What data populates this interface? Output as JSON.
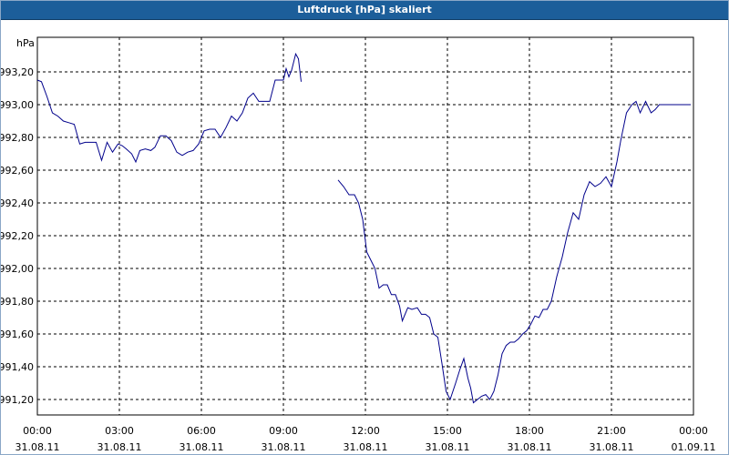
{
  "window": {
    "title": "Luftdruck [hPa] skaliert"
  },
  "chart_data": {
    "type": "line",
    "title": "Luftdruck [hPa] skaliert",
    "yunit": "hPa",
    "ylim": [
      991.1,
      993.4
    ],
    "y_ticks": [
      "993,20",
      "993,00",
      "992,80",
      "992,60",
      "992,40",
      "992,20",
      "992,00",
      "991,80",
      "991,60",
      "991,40",
      "991,20"
    ],
    "y_tick_values": [
      993.2,
      993.0,
      992.8,
      992.6,
      992.4,
      992.2,
      992.0,
      991.8,
      991.6,
      991.4,
      991.2
    ],
    "x_ticks": [
      {
        "time": "00:00",
        "date": "31.08.11"
      },
      {
        "time": "03:00",
        "date": "31.08.11"
      },
      {
        "time": "06:00",
        "date": "31.08.11"
      },
      {
        "time": "09:00",
        "date": "31.08.11"
      },
      {
        "time": "12:00",
        "date": "31.08.11"
      },
      {
        "time": "15:00",
        "date": "31.08.11"
      },
      {
        "time": "18:00",
        "date": "31.08.11"
      },
      {
        "time": "21:00",
        "date": "31.08.11"
      },
      {
        "time": "00:00",
        "date": "01.09.11"
      }
    ],
    "grid": true,
    "line_color": "#00008b",
    "series": [
      {
        "x_hours": [
          0.0,
          0.15,
          0.35,
          0.55,
          0.75,
          0.95,
          1.15,
          1.35,
          1.55,
          1.75,
          1.95,
          2.15,
          2.35,
          2.55,
          2.75,
          2.95,
          3.1,
          3.25,
          3.45,
          3.6,
          3.75,
          3.95,
          4.15,
          4.3,
          4.5,
          4.7,
          4.9,
          5.1,
          5.3,
          5.5,
          5.7,
          5.9,
          6.1,
          6.3,
          6.5,
          6.7,
          6.9,
          7.1,
          7.3,
          7.5,
          7.7,
          7.9,
          8.1,
          8.3,
          8.5,
          8.7,
          8.9,
          9.0,
          9.1,
          9.2,
          9.3,
          9.45,
          9.55,
          9.65
        ],
        "y": [
          993.15,
          993.14,
          993.05,
          992.95,
          992.93,
          992.9,
          992.89,
          992.88,
          992.76,
          992.77,
          992.77,
          992.77,
          992.66,
          992.77,
          992.71,
          992.76,
          992.75,
          992.73,
          992.7,
          992.65,
          992.72,
          992.73,
          992.72,
          992.74,
          992.81,
          992.81,
          992.78,
          992.71,
          992.69,
          992.71,
          992.72,
          992.76,
          992.84,
          992.85,
          992.85,
          992.8,
          992.86,
          992.93,
          992.9,
          992.95,
          993.04,
          993.07,
          993.02,
          993.02,
          993.02,
          993.15,
          993.15,
          993.15,
          993.22,
          993.17,
          993.21,
          993.31,
          993.28,
          993.14
        ]
      },
      {
        "x_hours": [
          11.0,
          11.2,
          11.4,
          11.6,
          11.75,
          11.9,
          12.05,
          12.2,
          12.35,
          12.5,
          12.65,
          12.8,
          12.95,
          13.1,
          13.25,
          13.35,
          13.55,
          13.7,
          13.9,
          14.05,
          14.2,
          14.35,
          14.5,
          14.65,
          14.8,
          14.95,
          15.1,
          15.3,
          15.45,
          15.6,
          15.75,
          15.85,
          15.95,
          16.1,
          16.25,
          16.4,
          16.55,
          16.7,
          16.85,
          17.0,
          17.15,
          17.3,
          17.45,
          17.6,
          17.75,
          17.9,
          18.05,
          18.2,
          18.35,
          18.5,
          18.65,
          18.8,
          19.0,
          19.2,
          19.4,
          19.6,
          19.8,
          20.0,
          20.2,
          20.4,
          20.6,
          20.8,
          21.0,
          21.2,
          21.35,
          21.55,
          21.75,
          21.9,
          22.05,
          22.25,
          22.45,
          22.6,
          22.75,
          22.95,
          23.1,
          23.25,
          23.45,
          23.6,
          23.75,
          23.9
        ],
        "y": [
          992.54,
          992.5,
          992.45,
          992.45,
          992.4,
          992.3,
          992.1,
          992.05,
          992.0,
          991.88,
          991.9,
          991.9,
          991.84,
          991.84,
          991.77,
          991.68,
          991.76,
          991.75,
          991.76,
          991.72,
          991.72,
          991.7,
          991.6,
          991.58,
          991.42,
          991.25,
          991.2,
          991.3,
          991.38,
          991.45,
          991.33,
          991.27,
          991.18,
          991.2,
          991.22,
          991.23,
          991.2,
          991.25,
          991.35,
          991.48,
          991.53,
          991.55,
          991.55,
          991.57,
          991.6,
          991.62,
          991.66,
          991.71,
          991.7,
          991.75,
          991.75,
          991.8,
          991.95,
          992.07,
          992.22,
          992.34,
          992.3,
          992.45,
          992.53,
          992.5,
          992.52,
          992.56,
          992.5,
          992.65,
          992.79,
          992.95,
          993.0,
          993.02,
          992.95,
          993.02,
          992.95,
          992.97,
          993.0,
          993.0,
          993.0,
          993.0,
          993.0,
          993.0,
          993.0,
          993.0
        ]
      }
    ]
  }
}
